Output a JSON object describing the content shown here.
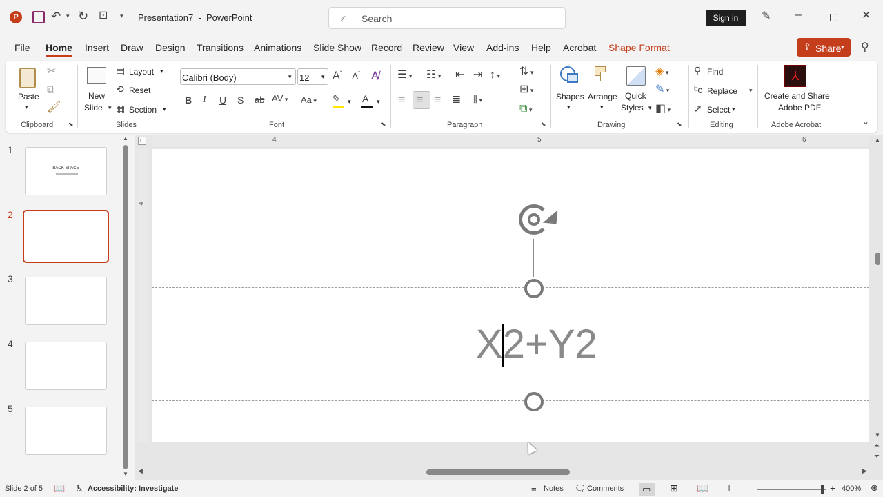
{
  "titlebar": {
    "title": "Presentation7  -  PowerPoint",
    "search_placeholder": "Search",
    "sign_in": "Sign in"
  },
  "tabs": [
    "File",
    "Home",
    "Insert",
    "Draw",
    "Design",
    "Transitions",
    "Animations",
    "Slide Show",
    "Record",
    "Review",
    "View",
    "Add-ins",
    "Help",
    "Acrobat",
    "Shape Format"
  ],
  "share": "Share",
  "ribbon": {
    "clipboard": {
      "paste": "Paste",
      "group": "Clipboard"
    },
    "slides": {
      "new_slide_1": "New",
      "new_slide_2": "Slide",
      "layout": "Layout",
      "reset": "Reset",
      "section": "Section",
      "group": "Slides"
    },
    "font": {
      "name": "Calibri (Body)",
      "size": "12",
      "group": "Font"
    },
    "paragraph": {
      "group": "Paragraph"
    },
    "drawing": {
      "shapes": "Shapes",
      "arrange": "Arrange",
      "quick_1": "Quick",
      "quick_2": "Styles",
      "group": "Drawing"
    },
    "editing": {
      "find": "Find",
      "replace": "Replace",
      "select": "Select",
      "group": "Editing"
    },
    "acrobat": {
      "line1": "Create and Share",
      "line2": "Adobe PDF",
      "group": "Adobe Acrobat"
    }
  },
  "ruler": {
    "marks": [
      "4",
      "5",
      "6"
    ],
    "vmark": "4"
  },
  "thumbnails": [
    {
      "num": "1",
      "title": "BACK-SPACE",
      "selected": false
    },
    {
      "num": "2",
      "title": "",
      "selected": true
    },
    {
      "num": "3",
      "title": "",
      "selected": false
    },
    {
      "num": "4",
      "title": "",
      "selected": false
    },
    {
      "num": "5",
      "title": "",
      "selected": false
    }
  ],
  "slide": {
    "text_before": "X",
    "text_after": "2+Y2"
  },
  "status": {
    "slide": "Slide 2 of 5",
    "accessibility": "Accessibility: Investigate",
    "notes": "Notes",
    "comments": "Comments",
    "zoom": "400%"
  },
  "colors": {
    "accent": "#c43e1c",
    "share_bg": "#c43e1c",
    "signin_bg": "#1f1f1f"
  }
}
